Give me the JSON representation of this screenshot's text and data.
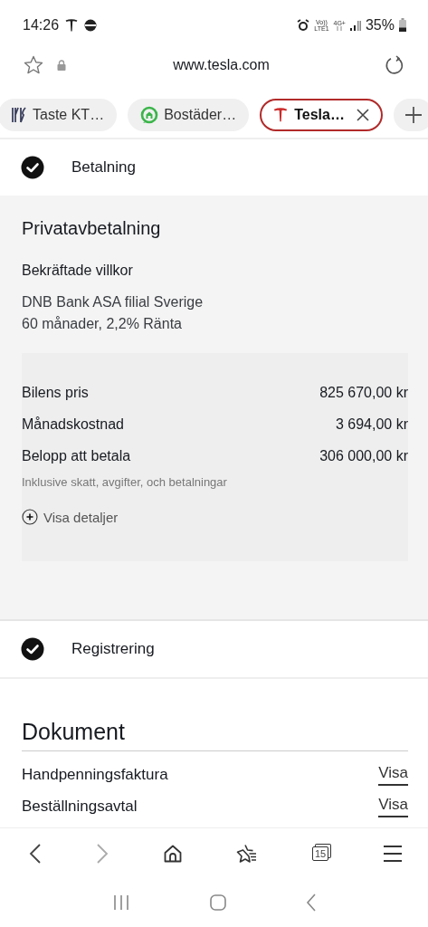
{
  "status_bar": {
    "time": "14:26",
    "volte": "Vo))",
    "lte": "LTE1",
    "network": "4G+",
    "battery": "35%"
  },
  "address_bar": {
    "url": "www.tesla.com"
  },
  "tabs": [
    {
      "label": "Taste KT…",
      "kind": "cutlery",
      "selected": false,
      "closable": false
    },
    {
      "label": "Bostäder…",
      "kind": "house",
      "selected": false,
      "closable": false
    },
    {
      "label": "Tesla…",
      "kind": "tesla",
      "selected": true,
      "closable": true
    }
  ],
  "steps_top": [
    {
      "label": "Betalning",
      "checked": true
    }
  ],
  "payment": {
    "title": "Privatavbetalning",
    "terms_heading": "Bekräftade villkor",
    "terms_lines": [
      "DNB Bank ASA filial Sverige",
      "60 månader, 2,2% Ränta"
    ],
    "rows": [
      {
        "label": "Bilens pris",
        "value": "825 670,00 kr"
      },
      {
        "label": "Månadskostnad",
        "value": "3 694,00 kr"
      },
      {
        "label": "Belopp att betala",
        "value": "306 000,00 kr"
      }
    ],
    "note": "Inklusive skatt, avgifter, och betalningar",
    "details_link": "Visa detaljer"
  },
  "steps_bottom": [
    {
      "label": "Registrering",
      "checked": true
    }
  ],
  "documents": {
    "title": "Dokument",
    "items": [
      {
        "label": "Handpenningsfaktura",
        "link": "Visa"
      },
      {
        "label": "Beställningsavtal",
        "link": "Visa"
      }
    ]
  },
  "browser_nav": {
    "back_disabled": false,
    "forward_disabled": true,
    "tab_count": "15"
  }
}
